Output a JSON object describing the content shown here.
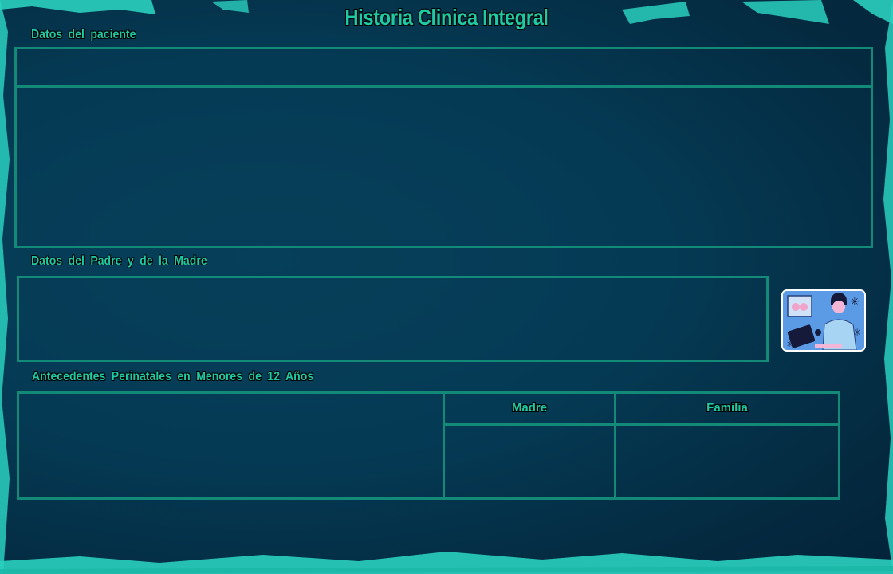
{
  "title": "Historia Clinica Integral",
  "sections": {
    "patient": {
      "label": "Datos del paciente"
    },
    "parents": {
      "label": "Datos del Padre y de la Madre"
    },
    "perinatal": {
      "label": "Antecedentes Perinatales en Menores de 12 Años",
      "columns": [
        "Madre",
        "Familia"
      ]
    }
  },
  "illustration": {
    "icon": "doctor-with-clipboard-icon"
  },
  "colors": {
    "accent": "#1fc9a4",
    "border": "#138a78",
    "background": "#053a54",
    "brush": "#2ad0bf"
  }
}
